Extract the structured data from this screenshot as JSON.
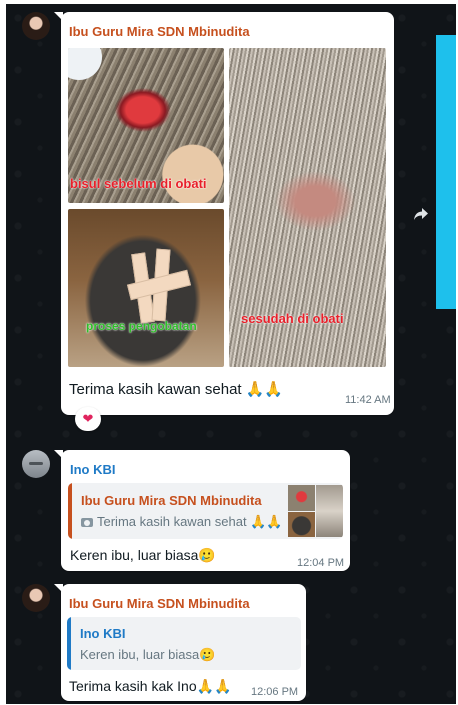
{
  "colors": {
    "chat_background": "#101418",
    "mira_name_color": "#c6501e",
    "ino_name_color": "#1f7ac6",
    "overlay_red": "#e8202a",
    "overlay_green": "#2fbe2a",
    "side_bar": "#1ec0ec"
  },
  "message_1": {
    "sender": "Ibu Guru Mira SDN Mbinudita",
    "photo_caption_before": "bisul sebelum di obati",
    "photo_caption_process": "proses pengobatan",
    "photo_caption_after": "sesudah di obati",
    "text": "Terima kasih kawan sehat 🙏🙏",
    "time": "11:42 AM",
    "reaction": "❤"
  },
  "message_2": {
    "sender": "Ino KBI",
    "quoted_sender": "Ibu Guru Mira SDN Mbinudita",
    "quoted_text": "Terima kasih kawan sehat 🙏🙏",
    "text": "Keren ibu, luar biasa🥲",
    "time": "12:04 PM"
  },
  "message_3": {
    "sender": "Ibu Guru Mira SDN Mbinudita",
    "quoted_sender": "Ino KBI",
    "quoted_text": "Keren ibu, luar biasa🥲",
    "text": "Terima kasih kak Ino🙏🙏",
    "time": "12:06 PM"
  },
  "icons": {
    "forward": "forward-icon",
    "camera": "camera-icon"
  }
}
